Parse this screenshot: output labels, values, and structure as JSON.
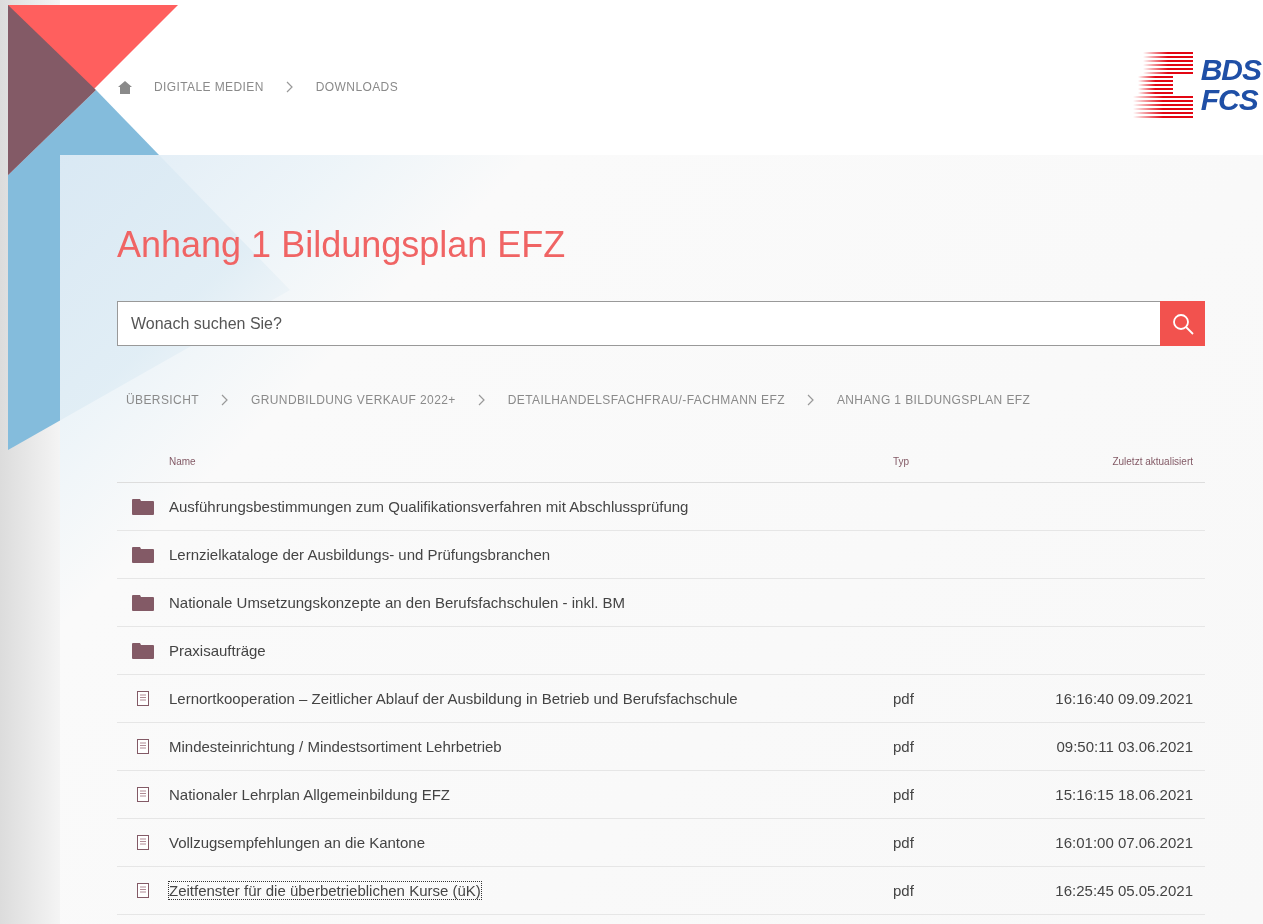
{
  "top_breadcrumb": [
    "DIGITALE MEDIEN",
    "DOWNLOADS"
  ],
  "logo": {
    "line_1": "BDS",
    "line_2": "FCS"
  },
  "title": "Anhang 1 Bildungsplan EFZ",
  "search": {
    "placeholder": "Wonach suchen Sie?"
  },
  "path": [
    "ÜBERSICHT",
    "GRUNDBILDUNG VERKAUF 2022+",
    "DETAILHANDELSFACHFRAU/-FACHMANN EFZ",
    "ANHANG 1 BILDUNGSPLAN EFZ"
  ],
  "table": {
    "columns": [
      "Name",
      "Typ",
      "Zuletzt aktualisiert"
    ],
    "rows": [
      {
        "kind": "folder",
        "name": "Ausführungsbestimmungen zum Qualifikationsverfahren mit Abschlussprüfung",
        "focused": false
      },
      {
        "kind": "folder",
        "name": "Lernzielkataloge der Ausbildungs- und Prüfungsbranchen",
        "focused": false
      },
      {
        "kind": "folder",
        "name": "Nationale Umsetzungskonzepte an den Berufsfachschulen - inkl. BM",
        "focused": false
      },
      {
        "kind": "folder",
        "name": "Praxisaufträge",
        "focused": false
      },
      {
        "kind": "file",
        "name": "Lernortkooperation – Zeitlicher Ablauf der Ausbildung in Betrieb und Berufsfachschule",
        "type": "pdf",
        "updated": "16:16:40 09.09.2021",
        "focused": false
      },
      {
        "kind": "file",
        "name": "Mindesteinrichtung / Mindestsortiment Lehrbetrieb",
        "type": "pdf",
        "updated": "09:50:11 03.06.2021",
        "focused": false
      },
      {
        "kind": "file",
        "name": "Nationaler Lehrplan Allgemeinbildung EFZ",
        "type": "pdf",
        "updated": "15:16:15 18.06.2021",
        "focused": false
      },
      {
        "kind": "file",
        "name": "Vollzugsempfehlungen an die Kantone",
        "type": "pdf",
        "updated": "16:01:00 07.06.2021",
        "focused": false
      },
      {
        "kind": "file",
        "name": "Zeitfenster für die überbetrieblichen Kurse (üK)",
        "type": "pdf",
        "updated": "16:25:45 05.05.2021",
        "focused": true
      }
    ]
  }
}
